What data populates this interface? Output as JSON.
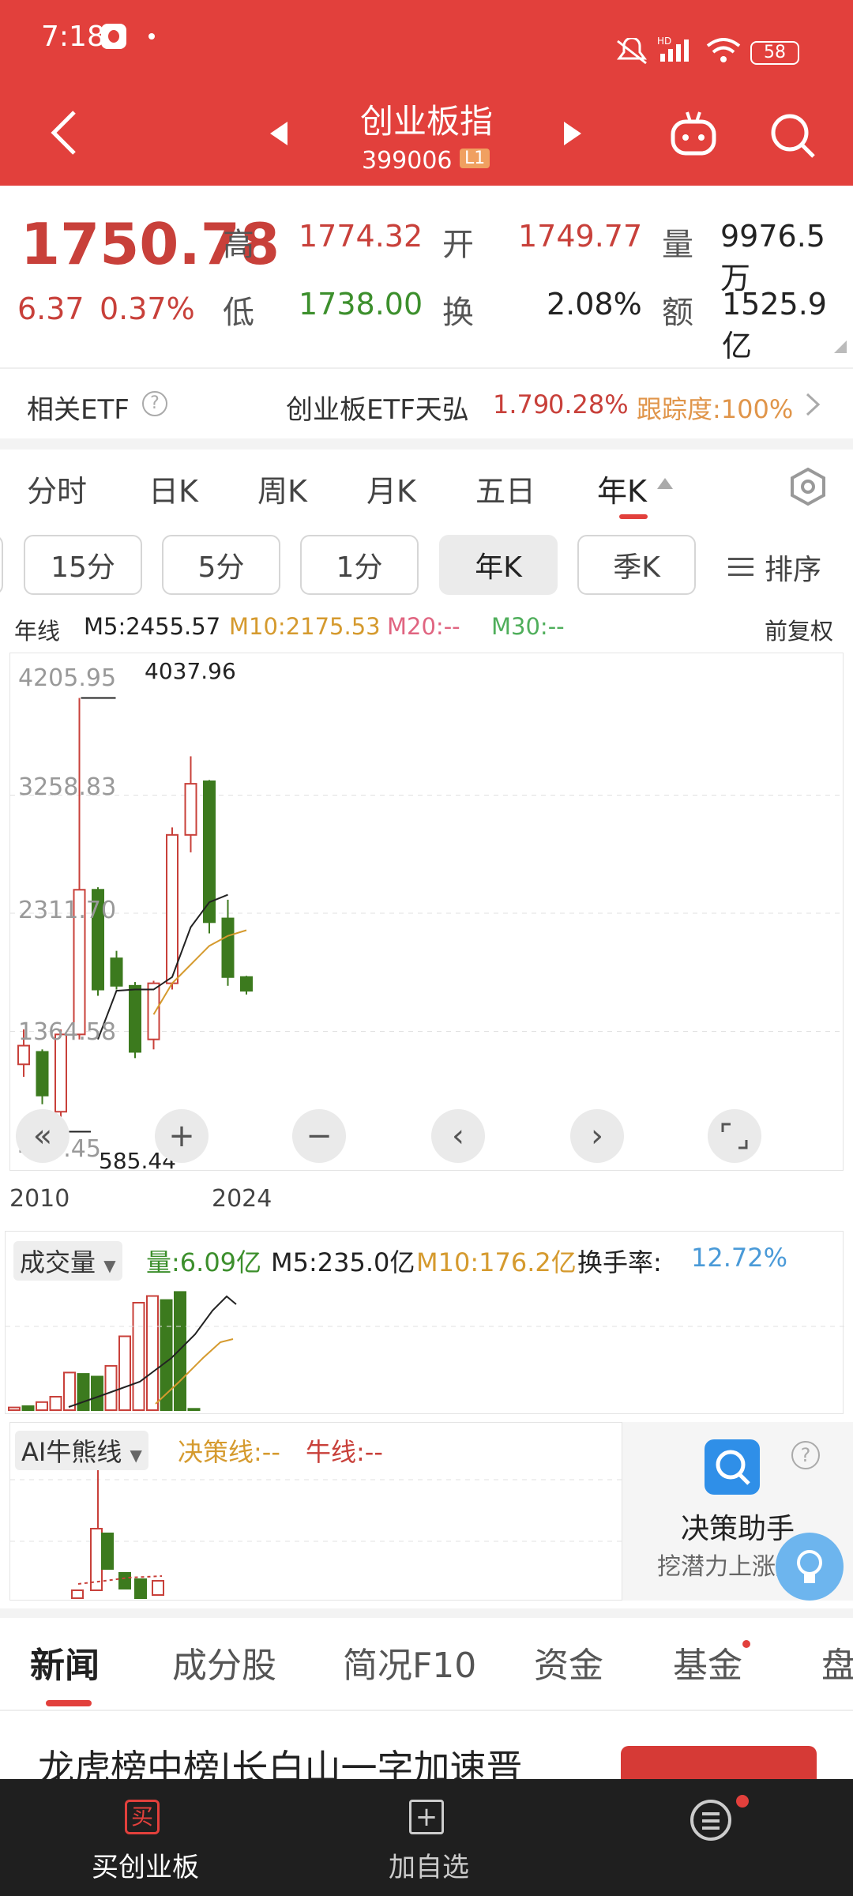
{
  "status": {
    "time": "7:18",
    "battery": "58"
  },
  "header": {
    "title": "创业板指",
    "code": "399006",
    "level": "L1"
  },
  "quote": {
    "price": "1750.78",
    "change": "6.37",
    "pct": "0.37%",
    "high_label": "高",
    "high": "1774.32",
    "open_label": "开",
    "open": "1749.77",
    "vol_label": "量",
    "vol": "9976.5万",
    "low_label": "低",
    "low": "1738.00",
    "turn_label": "换",
    "turn": "2.08%",
    "amt_label": "额",
    "amt": "1525.9亿"
  },
  "etf": {
    "label": "相关ETF",
    "name": "创业板ETF天弘",
    "price": "1.79",
    "pct": "0.28%",
    "track": "跟踪度:100%"
  },
  "tabs": [
    "分时",
    "日K",
    "周K",
    "月K",
    "五日",
    "年K"
  ],
  "pills": [
    "15分",
    "5分",
    "1分",
    "年K",
    "季K"
  ],
  "sort_label": "排序",
  "ma": {
    "label": "年线",
    "m5": "M5:2455.57",
    "m10": "M10:2175.53",
    "m20": "M20:--",
    "m30": "M30:--",
    "adj": "前复权"
  },
  "chart_data": {
    "type": "candlestick",
    "x_start": "2010",
    "x_end": "2024",
    "y_ticks": [
      "4205.95",
      "3258.83",
      "2311.70",
      "1364.58",
      "417.45"
    ],
    "max_label": "4037.96",
    "min_label": "585.44",
    "candles": [
      {
        "o": 1100,
        "c": 1250,
        "h": 1380,
        "l": 1000
      },
      {
        "o": 1200,
        "c": 850,
        "h": 1220,
        "l": 780
      },
      {
        "o": 720,
        "c": 1340,
        "h": 1380,
        "l": 585.44
      },
      {
        "o": 1340,
        "c": 2500,
        "h": 4037.96,
        "l": 1300
      },
      {
        "o": 2500,
        "c": 1700,
        "h": 2520,
        "l": 1650
      },
      {
        "o": 1950,
        "c": 1730,
        "h": 2010,
        "l": 1700
      },
      {
        "o": 1730,
        "c": 1200,
        "h": 1760,
        "l": 1150
      },
      {
        "o": 1300,
        "c": 1750,
        "h": 1770,
        "l": 1220
      },
      {
        "o": 1750,
        "c": 2940,
        "h": 3000,
        "l": 1700
      },
      {
        "o": 2940,
        "c": 3350,
        "h": 3570,
        "l": 2800
      },
      {
        "o": 3370,
        "c": 2240,
        "h": 3380,
        "l": 2150
      },
      {
        "o": 2270,
        "c": 1800,
        "h": 2420,
        "l": 1730
      },
      {
        "o": 1800,
        "c": 1690,
        "h": 1810,
        "l": 1660
      }
    ],
    "m5": [
      null,
      null,
      null,
      null,
      1300,
      1690,
      1700,
      1700,
      1800,
      2200,
      2400,
      2460,
      null
    ],
    "m10": [
      null,
      null,
      null,
      null,
      null,
      null,
      null,
      1500,
      1750,
      1900,
      2050,
      2130,
      2175.53
    ]
  },
  "volume": {
    "label": "成交量",
    "amt": "量:6.09亿",
    "m5": "M5:235.0亿",
    "m10": "M10:176.2亿",
    "turn_label": "换手率:",
    "turn": "12.72%",
    "bars": [
      0.02,
      0.03,
      0.06,
      0.1,
      0.28,
      0.27,
      0.25,
      0.33,
      0.55,
      0.8,
      0.85,
      0.82,
      0.88,
      0.01
    ]
  },
  "ai": {
    "label": "AI牛熊线",
    "decision": "决策线:--",
    "bull": "牛线:--"
  },
  "assistant": {
    "title": "决策助手",
    "subtitle": "挖潜力上涨股"
  },
  "news_tabs": [
    "新闻",
    "成分股",
    "简况F10",
    "资金",
    "基金",
    "盘"
  ],
  "headline": "龙虎榜中榜|长白山一字加速晋",
  "bottom": {
    "buy": "买创业板",
    "add": "加自选"
  }
}
